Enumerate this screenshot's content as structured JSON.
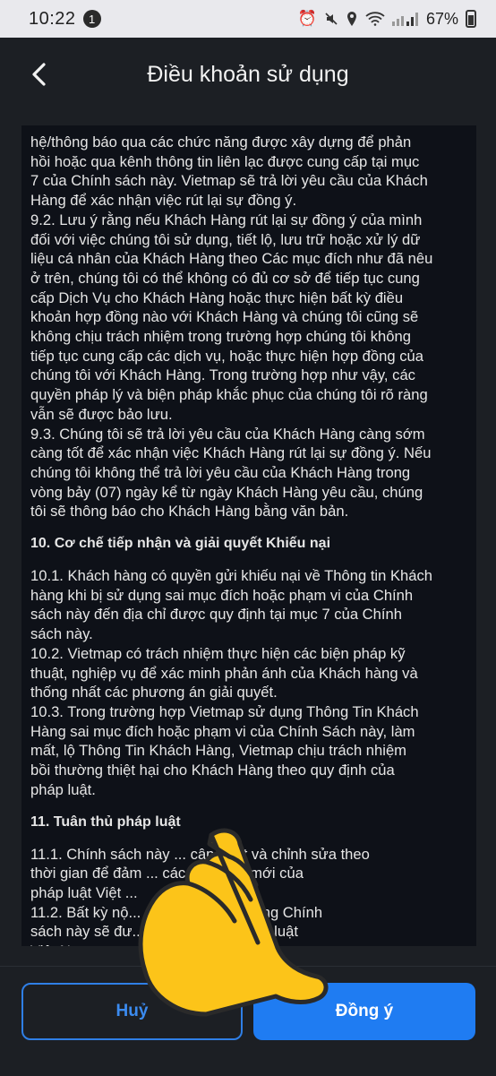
{
  "status_bar": {
    "time": "10:22",
    "notification_count": "1",
    "battery": "67%",
    "icons": [
      "alarm-icon",
      "mute-icon",
      "location-icon",
      "wifi-icon",
      "signal-icon",
      "battery-icon"
    ]
  },
  "header": {
    "title": "Điều khoản sử dụng",
    "back_icon": "chevron-left-icon"
  },
  "content": {
    "block1": [
      "hệ/thông báo qua các chức năng được xây dựng để phản",
      "hồi hoặc qua kênh thông tin liên lạc được cung cấp tại mục",
      "7 của Chính sách này. Vietmap sẽ trả lời yêu cầu của Khách",
      "Hàng để xác nhận việc rút lại sự đồng ý.",
      "9.2. Lưu ý rằng nếu Khách Hàng rút lại sự đồng ý của mình",
      "đối với việc chúng tôi sử dụng, tiết lộ, lưu trữ hoặc xử lý dữ",
      "liệu cá nhân của Khách Hàng theo Các mục đích như đã nêu",
      "ở trên, chúng tôi có thể không có đủ cơ sở để tiếp tục cung",
      "cấp Dịch Vụ cho Khách Hàng hoặc thực hiện bất kỳ điều",
      "khoản hợp đồng nào với Khách Hàng và chúng tôi cũng sẽ",
      "không chịu trách nhiệm trong trường hợp chúng tôi không",
      "tiếp tục cung cấp các dịch vụ, hoặc thực hiện hợp đồng của",
      "chúng tôi với Khách Hàng. Trong trường hợp như vậy, các",
      "quyền pháp lý và biện pháp khắc phục của chúng tôi rõ ràng",
      "vẫn sẽ được bảo lưu.",
      "9.3. Chúng tôi sẽ trả lời yêu cầu của Khách Hàng càng sớm",
      "càng tốt để xác nhận việc Khách Hàng rút lại sự đồng ý. Nếu",
      "chúng tôi không thể trả lời yêu cầu của Khách Hàng trong",
      "vòng bảy (07) ngày kể từ ngày Khách Hàng yêu cầu, chúng",
      "tôi sẽ thông báo cho Khách Hàng bằng văn bản."
    ],
    "section10_title": "10. Cơ chế tiếp nhận và giải quyết Khiếu nại",
    "block2": [
      "10.1. Khách hàng có quyền gửi khiếu nại về Thông tin Khách",
      "hàng khi bị sử dụng sai mục đích hoặc phạm vi của Chính",
      "sách này đến địa chỉ được quy định tại mục 7 của Chính",
      "sách này.",
      "10.2. Vietmap có trách nhiệm thực hiện các biện pháp kỹ",
      "thuật, nghiệp vụ để xác minh phản ánh của Khách hàng và",
      "thống nhất các phương án giải quyết.",
      "10.3. Trong trường hợp Vietmap sử dụng Thông Tin Khách",
      "Hàng sai mục đích hoặc phạm vi của Chính Sách này, làm",
      "mất, lộ Thông Tin Khách Hàng, Vietmap chịu trách nhiệm",
      "bồi thường thiệt hại cho Khách Hàng theo quy định của",
      "pháp luật."
    ],
    "section11_title": "11. Tuân thủ pháp luật",
    "block3": [
      "11.1. Chính sách này ... cập nhật và chỉnh sửa theo",
      "thời gian để đảm ... các quy định mới của",
      "pháp luật Việt ...",
      "11.2. Bất kỳ nộ... được quy định trong Chính",
      "sách này sẽ đư... quy định của pháp luật",
      "Việt Nam."
    ]
  },
  "buttons": {
    "cancel_label": "Huỷ",
    "accept_label": "Đồng ý"
  },
  "colors": {
    "accent": "#1f7cf2",
    "background": "#1c1f24",
    "content_background": "#0e1118",
    "hand_yellow": "#fcc419"
  }
}
